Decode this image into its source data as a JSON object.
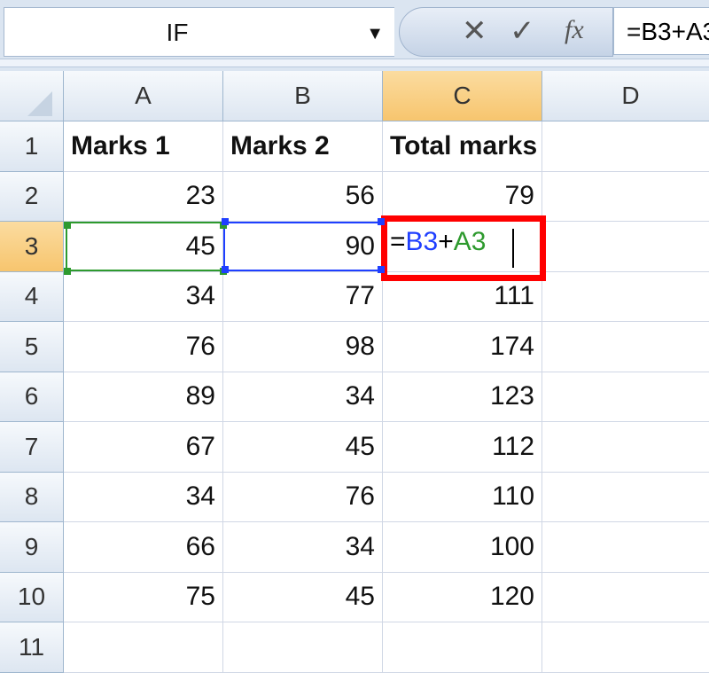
{
  "formula_bar": {
    "name_box": "IF",
    "cancel_icon": "✕",
    "enter_icon": "✓",
    "fx_label": "fx",
    "formula": "=B3+A3"
  },
  "columns": [
    "A",
    "B",
    "C",
    "D"
  ],
  "selected_column": "C",
  "selected_row": "3",
  "rows": [
    {
      "n": "1",
      "cells": [
        "Marks 1",
        "Marks 2",
        "Total marks",
        ""
      ]
    },
    {
      "n": "2",
      "cells": [
        "23",
        "56",
        "79",
        ""
      ]
    },
    {
      "n": "3",
      "cells": [
        "45",
        "90",
        "",
        ""
      ]
    },
    {
      "n": "4",
      "cells": [
        "34",
        "77",
        "111",
        ""
      ]
    },
    {
      "n": "5",
      "cells": [
        "76",
        "98",
        "174",
        ""
      ]
    },
    {
      "n": "6",
      "cells": [
        "89",
        "34",
        "123",
        ""
      ]
    },
    {
      "n": "7",
      "cells": [
        "67",
        "45",
        "112",
        ""
      ]
    },
    {
      "n": "8",
      "cells": [
        "34",
        "76",
        "110",
        ""
      ]
    },
    {
      "n": "9",
      "cells": [
        "66",
        "34",
        "100",
        ""
      ]
    },
    {
      "n": "10",
      "cells": [
        "75",
        "45",
        "120",
        ""
      ]
    },
    {
      "n": "11",
      "cells": [
        "",
        "",
        "",
        ""
      ]
    }
  ],
  "edit": {
    "eq": "=",
    "ref1": "B3",
    "plus": "+",
    "ref2": "A3"
  },
  "colors": {
    "ref1": "#1f3fff",
    "ref2": "#2e9a2e",
    "highlight": "#ff0000",
    "header_selected": "#f7c56e"
  }
}
